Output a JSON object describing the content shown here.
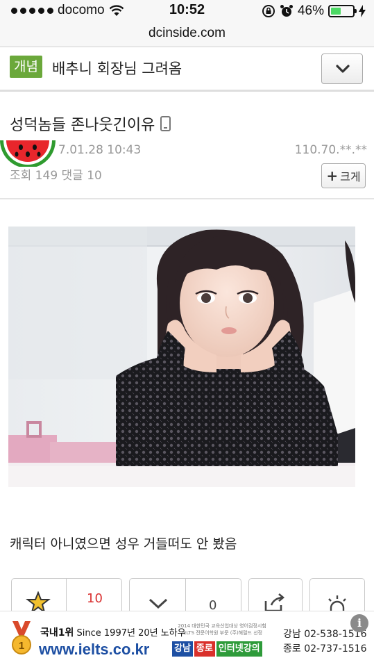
{
  "status_bar": {
    "carrier": "docomo",
    "time": "10:52",
    "battery_percent": "46%",
    "battery_level": 0.46
  },
  "browser": {
    "url": "dcinside.com"
  },
  "gallery": {
    "badge": "개념",
    "title": "배추니 회장님 그려옴"
  },
  "post": {
    "title": "성덕놈들 존나웃긴이유",
    "date": "7.01.28 10:43",
    "ip": "110.70.**.**",
    "stats": "조회 149  댓글 10",
    "enlarge_label": "크게",
    "enlarge_plus": "+",
    "body_text": "캐릭터 아니였으면 성우 거들떠도 안 봤음"
  },
  "recommend": {
    "up_count": "10",
    "down_count": "0"
  },
  "ad": {
    "rank_text": "국내1위",
    "since_text": "Since 1997년 20년 노하우",
    "url": "www.ielts.co.kr",
    "small_line1": "2014 대한민국 교육산업대상 영어검정시험",
    "small_line2": "IELTS 전문어학원 부문 (주)해럴드 선정",
    "tags": [
      "강남",
      "종로",
      "인터넷강의"
    ],
    "phone1": "강남 02-538-1516",
    "phone2": "종로 02-737-1516",
    "info_label": "i",
    "medal_number": "1"
  },
  "colors": {
    "badge_green": "#6ba83b",
    "ad_blue": "#1d4fa3",
    "tag_blue": "#1d4fa3",
    "tag_red": "#d9302b",
    "tag_green": "#2e9b3a",
    "battery_green": "#4cd964"
  }
}
